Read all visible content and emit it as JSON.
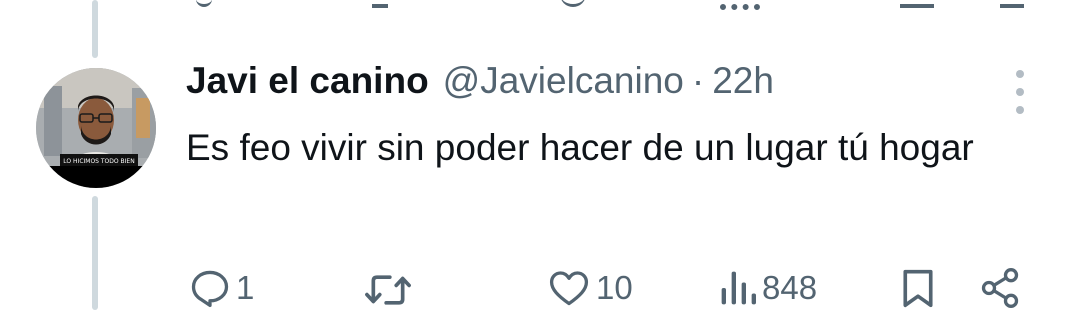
{
  "tweet": {
    "author_name": "Javi el canino",
    "handle": "@Javielcanino",
    "separator": "·",
    "time": "22h",
    "text": "Es feo vivir sin poder hacer de un lugar tú hogar",
    "avatar_caption": "LO HICIMOS TODO BIEN"
  },
  "actions": {
    "replies": "1",
    "retweets": "",
    "likes": "10",
    "views": "848"
  },
  "icons": {
    "reply": "reply-icon",
    "retweet": "retweet-icon",
    "like": "heart-icon",
    "views": "views-icon",
    "bookmark": "bookmark-icon",
    "share": "share-icon",
    "more": "more-vertical-icon"
  },
  "colors": {
    "text": "#0f1419",
    "secondary": "#536471",
    "thread_line": "#cfd9de"
  }
}
